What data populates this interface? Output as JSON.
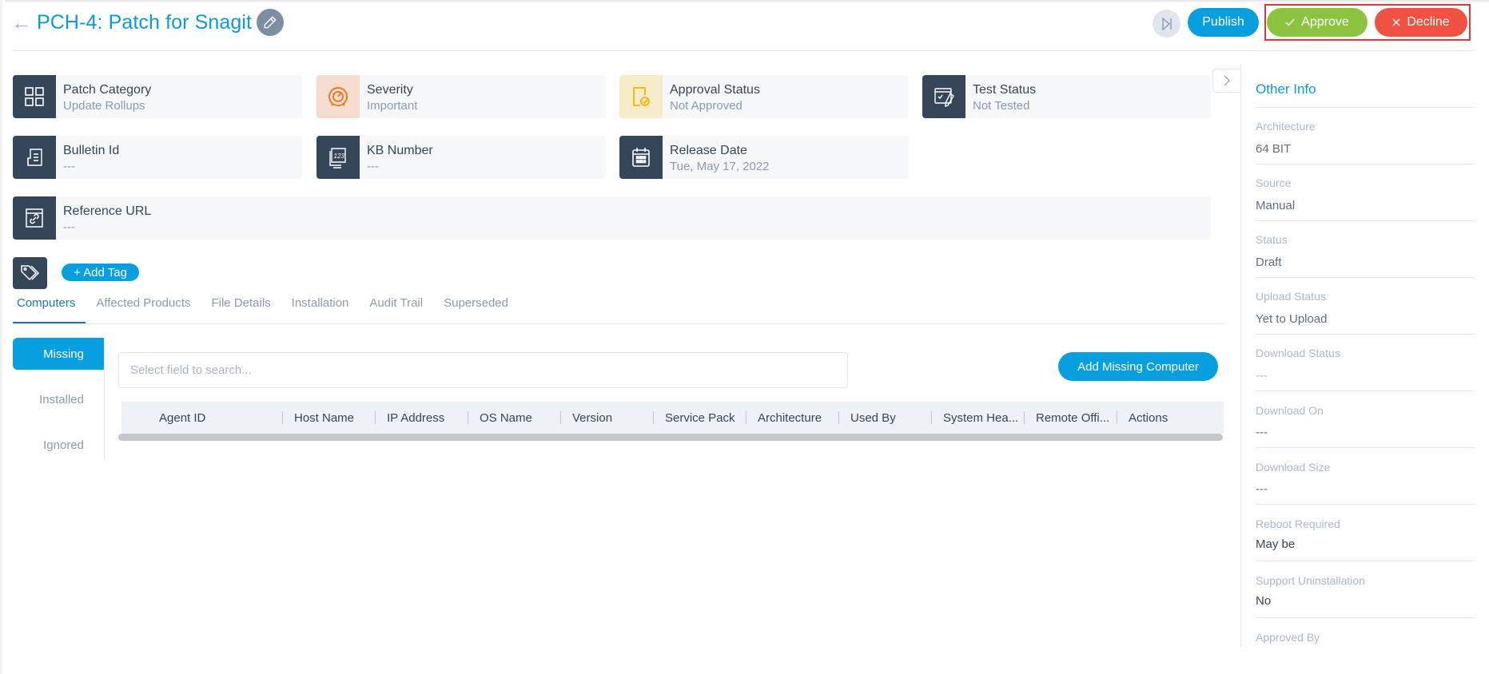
{
  "header": {
    "title": "PCH-4: Patch for Snagit",
    "back_icon": "arrow-left-icon",
    "edit_icon": "pencil-icon",
    "skip_icon": "skip-forward-icon",
    "publish_label": "Publish",
    "approve_label": "Approve",
    "decline_label": "Decline"
  },
  "cards": [
    {
      "label": "Patch Category",
      "value": "Update Rollups",
      "icon": "grid-icon"
    },
    {
      "label": "Severity",
      "value": "Important",
      "icon": "gauge-icon"
    },
    {
      "label": "Approval Status",
      "value": "Not Approved",
      "icon": "document-check-icon"
    },
    {
      "label": "Test Status",
      "value": "Not Tested",
      "icon": "test-edit-icon"
    },
    {
      "label": "Bulletin Id",
      "value": "---",
      "icon": "bulletin-icon"
    },
    {
      "label": "KB Number",
      "value": "---",
      "icon": "kb-number-icon"
    },
    {
      "label": "Release Date",
      "value": "Tue, May 17, 2022",
      "icon": "calendar-icon"
    },
    {
      "label": "Reference URL",
      "value": "---",
      "icon": "link-icon"
    }
  ],
  "tags": {
    "icon": "tag-icon",
    "add_label": "+ Add Tag"
  },
  "tabs": [
    {
      "label": "Computers",
      "active": true
    },
    {
      "label": "Affected Products"
    },
    {
      "label": "File Details"
    },
    {
      "label": "Installation"
    },
    {
      "label": "Audit Trail"
    },
    {
      "label": "Superseded"
    }
  ],
  "side_tabs": [
    {
      "label": "Missing",
      "active": true
    },
    {
      "label": "Installed"
    },
    {
      "label": "Ignored"
    }
  ],
  "search": {
    "placeholder": "Select field to search...",
    "value": ""
  },
  "add_missing_label": "Add Missing Computer",
  "table": {
    "columns": [
      "Agent ID",
      "Host Name",
      "IP Address",
      "OS Name",
      "Version",
      "Service Pack",
      "Architecture",
      "Used By",
      "System Hea...",
      "Remote Offi...",
      "Actions"
    ],
    "rows": []
  },
  "other_info": {
    "title": "Other Info",
    "fields": [
      {
        "label": "Architecture",
        "value": "64 BIT"
      },
      {
        "label": "Source",
        "value": "Manual"
      },
      {
        "label": "Status",
        "value": "Draft"
      },
      {
        "label": "Upload Status",
        "value": "Yet to Upload"
      },
      {
        "label": "Download Status",
        "value": "---"
      },
      {
        "label": "Download On",
        "value": "---"
      },
      {
        "label": "Download Size",
        "value": "---"
      },
      {
        "label": "Reboot Required",
        "value": "May be"
      },
      {
        "label": "Support Uninstallation",
        "value": "No"
      },
      {
        "label": "Approved By",
        "value": ""
      }
    ]
  },
  "colors": {
    "primary": "#089fde",
    "approve": "#8bc540",
    "decline": "#f05142",
    "dark_icon_bg": "#364659",
    "highlight_frame": "#e8353a"
  }
}
